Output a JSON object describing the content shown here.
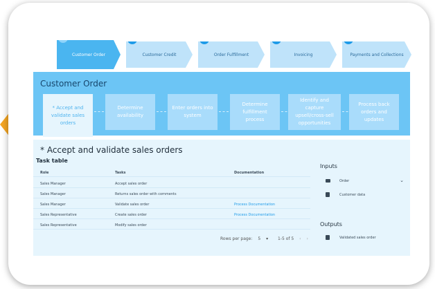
{
  "steps": [
    {
      "num": "1",
      "label": "Customer Order",
      "active": true
    },
    {
      "num": "2",
      "label": "Customer Credit"
    },
    {
      "num": "3",
      "label": "Order Fulfillment"
    },
    {
      "num": "4",
      "label": "Invoicing"
    },
    {
      "num": "5",
      "label": "Payments and Collections"
    }
  ],
  "phase": {
    "title": "Customer Order",
    "tasks": [
      "* Accept and validate sales orders",
      "Determine availability",
      "Enter orders into system",
      "Determine fulfillment process",
      "Identify and capture upsell/cross-sell opportunities",
      "Process back orders and updates"
    ]
  },
  "detail": {
    "title": "* Accept and validate sales orders",
    "task_table_label": "Task table",
    "columns": [
      "Role",
      "Tasks",
      "Documentation"
    ],
    "rows": [
      {
        "role": "Sales Manager",
        "task": "Accept sales order",
        "doc": ""
      },
      {
        "role": "Sales Manager",
        "task": "Returns sales order with comments",
        "doc": ""
      },
      {
        "role": "Sales Manager",
        "task": "Validate sales order",
        "doc": "Process Documentation"
      },
      {
        "role": "Sales Representative",
        "task": "Create sales order",
        "doc": "Process Documentation"
      },
      {
        "role": "Sales Representative",
        "task": "Modify sales order",
        "doc": ""
      }
    ],
    "pager": {
      "rows_label": "Rows per page:",
      "rows_value": "5",
      "range": "1-5 of 5"
    },
    "inputs_label": "Inputs",
    "inputs": [
      {
        "icon": "folder-icon",
        "label": "Order"
      },
      {
        "icon": "document-icon",
        "label": "Customer data"
      }
    ],
    "outputs_label": "Outputs",
    "outputs": [
      {
        "icon": "document-icon",
        "label": "Validated sales order"
      }
    ]
  }
}
